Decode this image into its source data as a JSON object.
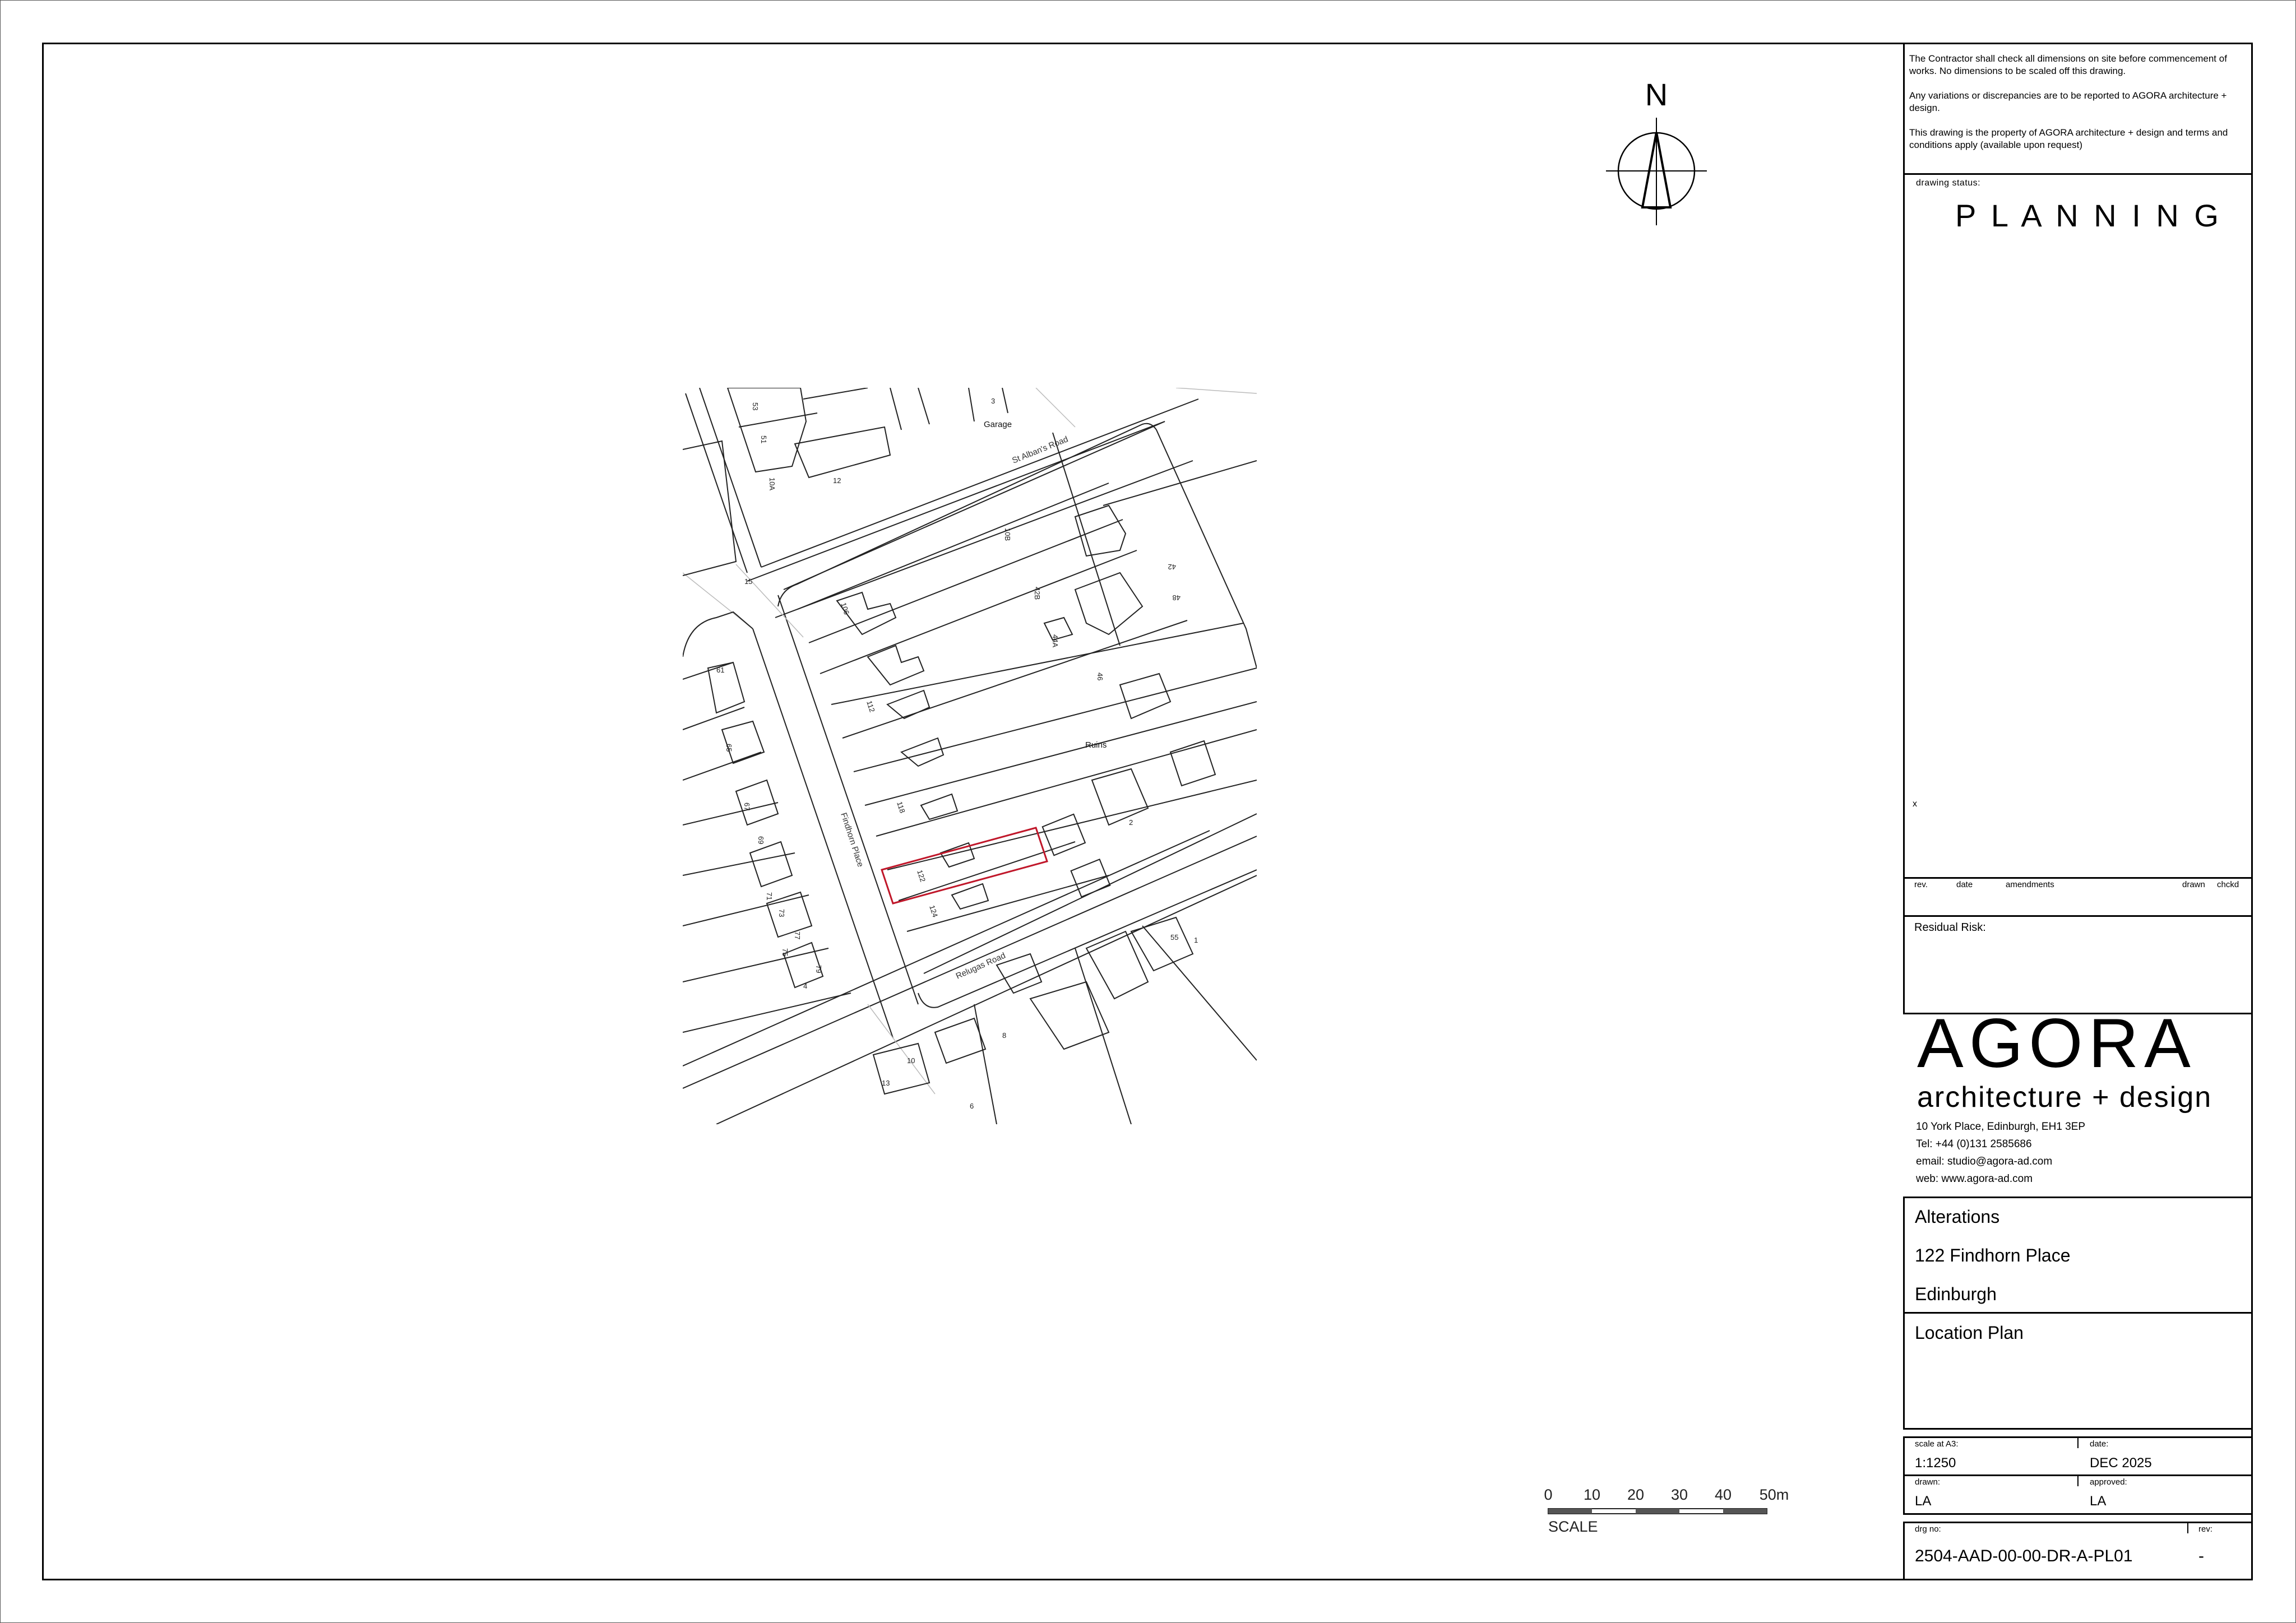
{
  "notes": [
    "The Contractor shall check all dimensions on site before commencement of works. No dimensions to be scaled off this drawing.",
    "Any variations or discrepancies are to be reported to AGORA architecture + design.",
    "This drawing is the property of AGORA architecture + design and terms and conditions apply (available upon request)"
  ],
  "status": {
    "label": "drawing status:",
    "value": "P L A N N I N G",
    "marker": "x"
  },
  "revision_table": {
    "rev": "rev.",
    "date": "date",
    "amendments": "amendments",
    "drawn": "drawn",
    "chckd": "chckd"
  },
  "residual_risk": {
    "label": "Residual Risk:"
  },
  "company": {
    "logo": "AGORA",
    "tagline": "architecture + design",
    "address": "10 York Place, Edinburgh, EH1 3EP",
    "tel": "Tel: +44  (0)131 2585686",
    "email": "email: studio@agora-ad.com",
    "web": "web: www.agora-ad.com"
  },
  "project": {
    "line1": "Alterations",
    "line2": "122 Findhorn Place",
    "line3": "Edinburgh",
    "drawing_title": "Location Plan"
  },
  "details": {
    "scale_label": "scale at A3:",
    "scale": "1:1250",
    "date_label": "date:",
    "date": "DEC 2025",
    "drawn_label": "drawn:",
    "drawn": "LA",
    "approved_label": "approved:",
    "approved": "LA",
    "drg_label": "drg no:",
    "drg_no": "2504-AAD-00-00-DR-A-PL01",
    "rev_label": "rev:",
    "rev": "-"
  },
  "north": {
    "label": "N"
  },
  "scale_bar": {
    "ticks": [
      "0",
      "10",
      "20",
      "30",
      "40",
      "50m"
    ],
    "label": "SCALE"
  },
  "map": {
    "street_labels": [
      "St Alban's Road",
      "Findhorn Place",
      "Relugas Road"
    ],
    "place_labels": [
      "Garage",
      "Ruins"
    ],
    "house_numbers": [
      "3",
      "12",
      "106",
      "112",
      "118",
      "122",
      "124",
      "42B",
      "44A",
      "46",
      "48",
      "42",
      "61",
      "65",
      "67",
      "69",
      "71",
      "73",
      "75",
      "77",
      "79",
      "4",
      "2",
      "1",
      "6",
      "8",
      "10",
      "13",
      "15",
      "51",
      "53",
      "55",
      "10A",
      "10B"
    ]
  },
  "colors": {
    "site_boundary": "#c0172a",
    "linework": "#222222"
  }
}
